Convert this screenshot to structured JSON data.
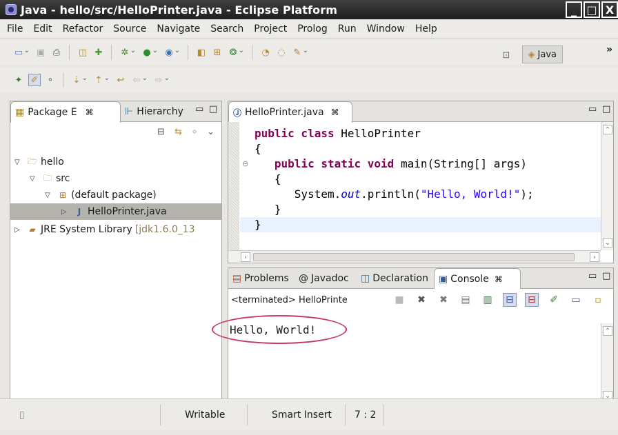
{
  "window": {
    "title": "Java - hello/src/HelloPrinter.java - Eclipse Platform",
    "controls": [
      "_",
      "□",
      "X"
    ]
  },
  "menu": [
    "File",
    "Edit",
    "Refactor",
    "Source",
    "Navigate",
    "Search",
    "Project",
    "Prolog",
    "Run",
    "Window",
    "Help"
  ],
  "perspective": {
    "label": "Java",
    "chevron": "»"
  },
  "package_explorer": {
    "tab_label": "Package E",
    "other_tab_label": "Hierarchy",
    "tree": [
      {
        "label": "hello",
        "level": 0,
        "expanded": true,
        "icon": "project-icon"
      },
      {
        "label": "src",
        "level": 1,
        "expanded": true,
        "icon": "source-folder-icon"
      },
      {
        "label": "(default package)",
        "level": 2,
        "expanded": true,
        "icon": "package-icon"
      },
      {
        "label": "HelloPrinter.java",
        "level": 3,
        "expanded": false,
        "icon": "java-file-icon",
        "selected": true
      },
      {
        "label": "JRE System Library",
        "extra": "[jdk1.6.0_13",
        "level": 0,
        "expanded": false,
        "icon": "library-icon"
      }
    ]
  },
  "editor": {
    "tab_label": "HelloPrinter.java",
    "code_lines": {
      "l1_kw": "public class ",
      "l1_rest": "HelloPrinter",
      "l2": "{",
      "l3_kw": "public static void ",
      "l3_rest": "main(String[] args)",
      "l4": "{",
      "l5_a": "System.",
      "l5_fld": "out",
      "l5_b": ".println(",
      "l5_str": "\"Hello, World!\"",
      "l5_c": ");",
      "l6": "}",
      "l7": "}"
    }
  },
  "bottom_tabs": {
    "problems": "Problems",
    "javadoc": "Javadoc",
    "declaration": "Declaration",
    "console": "Console"
  },
  "console": {
    "header": "<terminated> HelloPrinte",
    "output": "Hello, World!"
  },
  "status": {
    "writable": "Writable",
    "insert_mode": "Smart Insert",
    "position": "7 : 2"
  },
  "colors": {
    "keyword": "#7f0055",
    "string": "#2a00ff",
    "field": "#0000c0",
    "highlight_ellipse": "#c43a63"
  }
}
